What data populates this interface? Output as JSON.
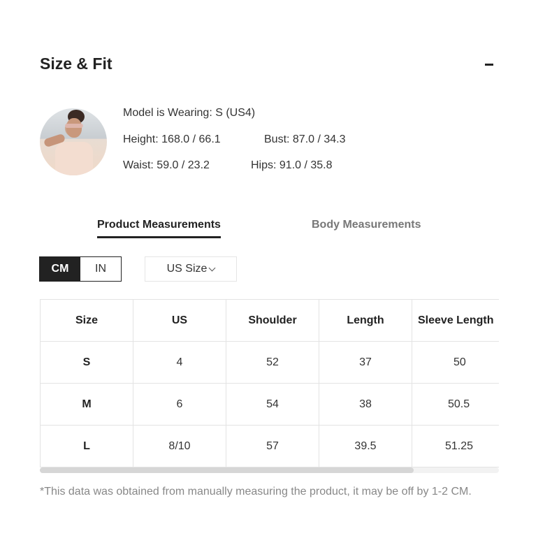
{
  "section": {
    "title": "Size & Fit",
    "collapse_icon": "minus-icon"
  },
  "model": {
    "avatar_icon": "model-photo",
    "wearing": "Model is Wearing: S (US4)",
    "height": "Height: 168.0 / 66.1",
    "bust": "Bust: 87.0 / 34.3",
    "waist": "Waist: 59.0 / 23.2",
    "hips": "Hips: 91.0 / 35.8"
  },
  "tabs": [
    {
      "label": "Product Measurements",
      "active": true
    },
    {
      "label": "Body Measurements",
      "active": false
    }
  ],
  "units": {
    "options": [
      "CM",
      "IN"
    ],
    "selected": "CM"
  },
  "size_select": {
    "value": "US Size",
    "icon": "chevron-down-icon"
  },
  "table": {
    "headers": [
      "Size",
      "US",
      "Shoulder",
      "Length",
      "Sleeve Length"
    ],
    "rows": [
      [
        "S",
        "4",
        "52",
        "37",
        "50"
      ],
      [
        "M",
        "6",
        "54",
        "38",
        "50.5"
      ],
      [
        "L",
        "8/10",
        "57",
        "39.5",
        "51.25"
      ]
    ]
  },
  "note": "*This data was obtained from manually measuring the product, it may be off by 1-2 CM."
}
